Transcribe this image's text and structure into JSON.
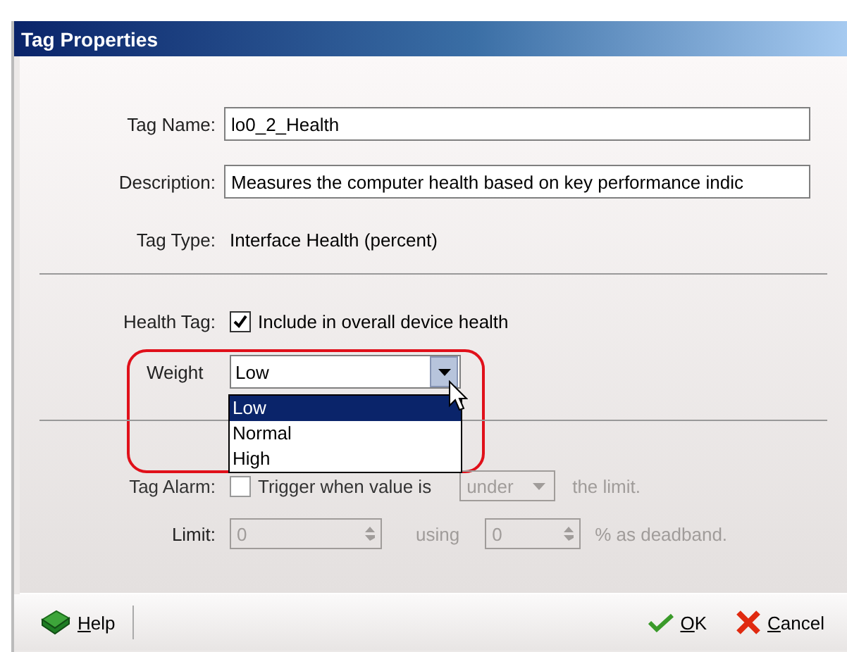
{
  "window": {
    "title": "Tag Properties"
  },
  "fields": [
    {
      "kind": "input",
      "label": "Tag Name:",
      "value": "lo0_2_Health"
    },
    {
      "kind": "input",
      "label": "Description:",
      "value": "Measures the computer health based on key performance indic"
    },
    {
      "kind": "text",
      "label": "Tag Type:",
      "value": "Interface Health (percent)"
    }
  ],
  "health": {
    "label": "Health Tag:",
    "checkbox": {
      "label": "Include in overall device health",
      "checked": true
    },
    "weight": {
      "label": "Weight",
      "value": "Low",
      "expanded": true,
      "options": [
        {
          "label": "Low",
          "selected": true
        },
        {
          "label": "Normal",
          "selected": false
        },
        {
          "label": "High",
          "selected": false
        }
      ]
    }
  },
  "alarm": {
    "disabled": true,
    "label": "Tag Alarm:",
    "checkbox": {
      "label": "Trigger when value is",
      "checked": false
    },
    "condition": "under",
    "condition_suffix": "the limit.",
    "limit_label": "Limit:",
    "limit_value": "0",
    "using_label": "using",
    "deadband_value": "0",
    "deadband_suffix": "% as deadband."
  },
  "footer": {
    "help": "Help",
    "buttons": [
      {
        "kind": "ok",
        "label": "OK"
      },
      {
        "kind": "cancel",
        "label": "Cancel"
      }
    ]
  }
}
